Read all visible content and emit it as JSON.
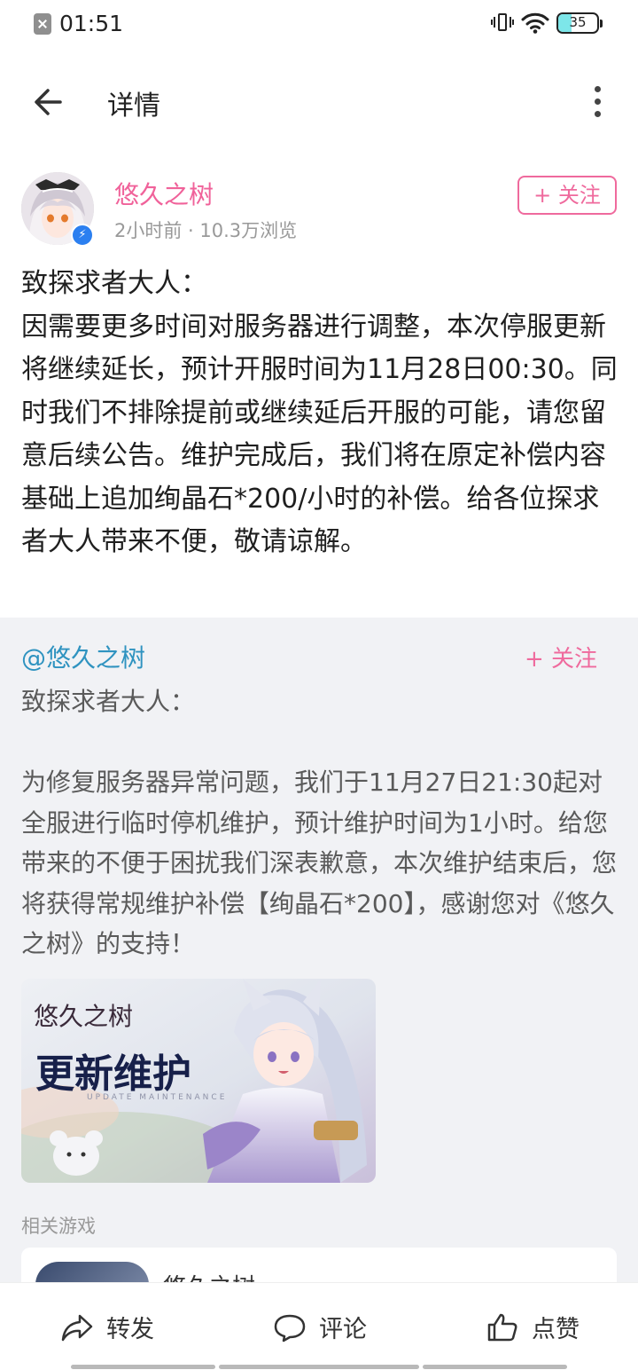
{
  "status_bar": {
    "time": "01:51",
    "battery": "35",
    "battery_level": 0.35,
    "notification_icon": "close-box-icon",
    "icons": [
      "vibrate-icon",
      "wifi-icon",
      "battery-icon"
    ]
  },
  "header": {
    "title": "详情",
    "back_icon": "arrow-left-icon",
    "more_icon": "more-vertical-icon"
  },
  "post": {
    "author_name": "悠久之树",
    "meta": "2小时前 · 10.3万浏览",
    "follow_label": "+ 关注",
    "text": "致探求者大人：\n因需要更多时间对服务器进行调整，本次停服更新将继续延长，预计开服时间为11月28日00:30。同时我们不排除提前或继续延后开服的可能，请您留意后续公告。维护完成后，我们将在原定补偿内容基础上追加绚晶石*200/小时的补偿。给各位探求者大人带来不便，敬请谅解。"
  },
  "quote": {
    "author": "@悠久之树",
    "follow_label": "+ 关注",
    "text": "致探求者大人：\n\n为修复服务器异常问题，我们于11月27日21:30起对全服进行临时停机维护，预计维护时间为1小时。给您带来的不便于困扰我们深表歉意，本次维护结束后，您将获得常规维护补偿【绚晶石*200】，感谢您对《悠久之树》的支持！",
    "banner": {
      "logo": "悠久之树",
      "title": "更新维护",
      "subtitle": "UPDATE MAINTENANCE"
    },
    "related_label": "相关游戏",
    "related_game": "悠久之树"
  },
  "bottom_bar": {
    "share_label": "转发",
    "comment_label": "评论",
    "like_label": "点赞"
  },
  "colors": {
    "accent_pink": "#ef6a9d",
    "link_blue": "#2f93c0",
    "quote_bg": "#f1f2f5"
  }
}
